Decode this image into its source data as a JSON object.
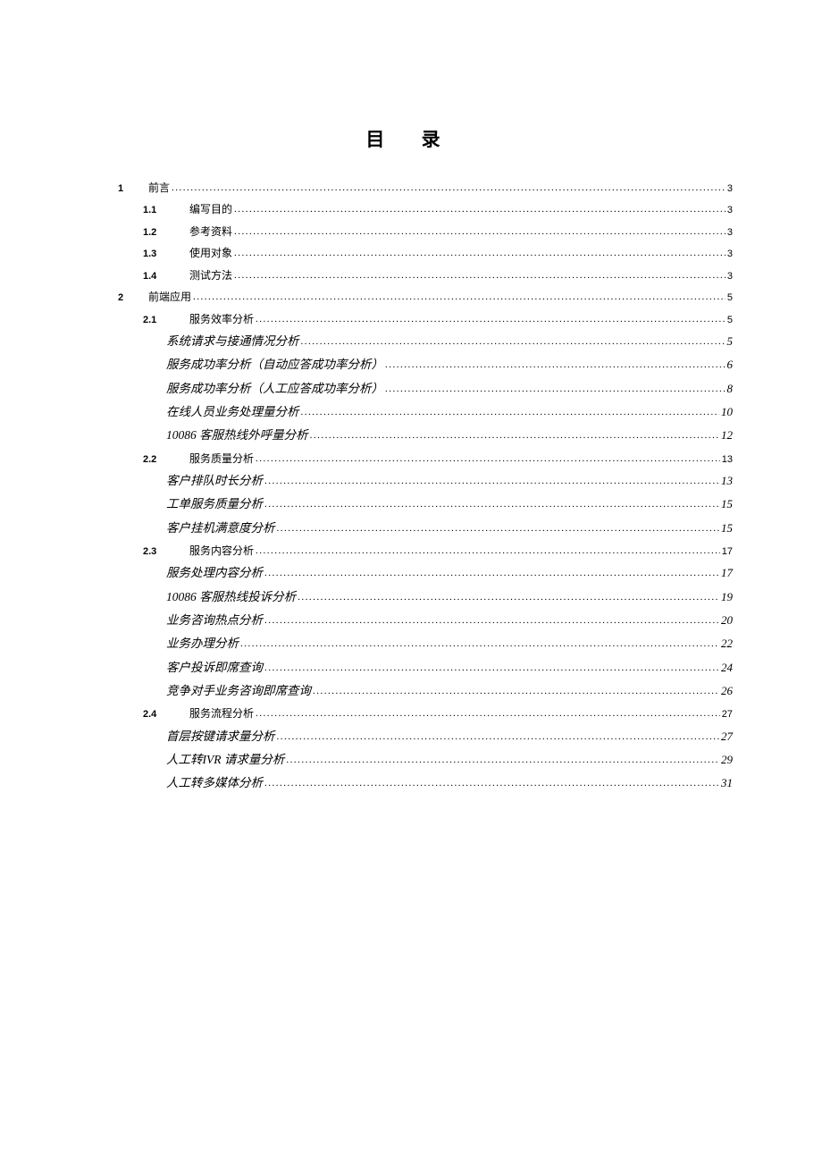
{
  "title": "目 录",
  "toc": [
    {
      "level": 0,
      "num": "1",
      "label": "前言",
      "page": "3",
      "italic": false
    },
    {
      "level": 1,
      "num": "1.1",
      "label": "编写目的",
      "page": "3",
      "italic": false
    },
    {
      "level": 1,
      "num": "1.2",
      "label": "参考资料",
      "page": "3",
      "italic": false
    },
    {
      "level": 1,
      "num": "1.3",
      "label": "使用对象",
      "page": "3",
      "italic": false
    },
    {
      "level": 1,
      "num": "1.4",
      "label": "测试方法",
      "page": "3",
      "italic": false
    },
    {
      "level": 0,
      "num": "2",
      "label": "前端应用",
      "page": "5",
      "italic": false
    },
    {
      "level": 1,
      "num": "2.1",
      "label": "服务效率分析",
      "page": "5",
      "italic": false
    },
    {
      "level": 2,
      "num": "",
      "label": "系统请求与接通情况分析",
      "page": "5",
      "italic": true
    },
    {
      "level": 2,
      "num": "",
      "label": "服务成功率分析（自动应答成功率分析）",
      "page": "6",
      "italic": true
    },
    {
      "level": 2,
      "num": "",
      "label": "服务成功率分析（人工应答成功率分析）",
      "page": "8",
      "italic": true
    },
    {
      "level": 2,
      "num": "",
      "label": "在线人员业务处理量分析",
      "page": "10",
      "italic": true
    },
    {
      "level": 2,
      "num": "",
      "label": "10086 客服热线外呼量分析",
      "page": "12",
      "italic": true
    },
    {
      "level": 1,
      "num": "2.2",
      "label": "服务质量分析",
      "page": "13",
      "italic": false
    },
    {
      "level": 2,
      "num": "",
      "label": "客户排队时长分析",
      "page": "13",
      "italic": true
    },
    {
      "level": 2,
      "num": "",
      "label": "工单服务质量分析",
      "page": "15",
      "italic": true
    },
    {
      "level": 2,
      "num": "",
      "label": "客户挂机满意度分析",
      "page": "15",
      "italic": true
    },
    {
      "level": 1,
      "num": "2.3",
      "label": "服务内容分析",
      "page": "17",
      "italic": false
    },
    {
      "level": 2,
      "num": "",
      "label": "服务处理内容分析",
      "page": "17",
      "italic": true
    },
    {
      "level": 2,
      "num": "",
      "label": "10086 客服热线投诉分析",
      "page": "19",
      "italic": true
    },
    {
      "level": 2,
      "num": "",
      "label": "业务咨询热点分析",
      "page": "20",
      "italic": true
    },
    {
      "level": 2,
      "num": "",
      "label": "业务办理分析",
      "page": "22",
      "italic": true
    },
    {
      "level": 2,
      "num": "",
      "label": "客户投诉即席查询",
      "page": "24",
      "italic": true
    },
    {
      "level": 2,
      "num": "",
      "label": "竞争对手业务咨询即席查询",
      "page": "26",
      "italic": true
    },
    {
      "level": 1,
      "num": "2.4",
      "label": "服务流程分析",
      "page": "27",
      "italic": false
    },
    {
      "level": 2,
      "num": "",
      "label": "首层按键请求量分析",
      "page": "27",
      "italic": true
    },
    {
      "level": 2,
      "num": "",
      "label": "人工转IVR 请求量分析",
      "page": "29",
      "italic": true
    },
    {
      "level": 2,
      "num": "",
      "label": "人工转多媒体分析",
      "page": "31",
      "italic": true
    }
  ]
}
